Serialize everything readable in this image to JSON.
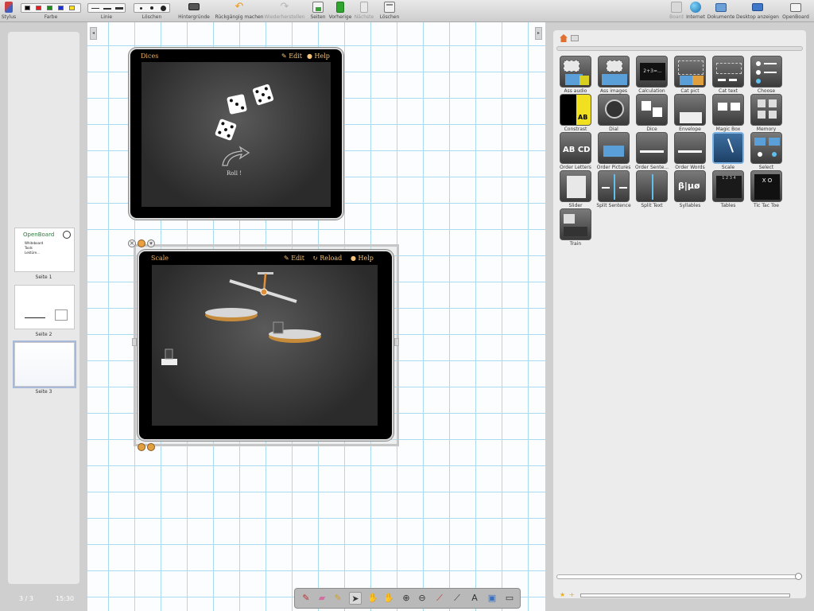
{
  "toolbar": {
    "stylus": "Stylus",
    "color": "Farbe",
    "colors": [
      "#000000",
      "#e02020",
      "#1f8a1f",
      "#2030d0",
      "#ffe020"
    ],
    "line": "Linie",
    "erase": "Löschen",
    "backgrounds": "Hintergründe",
    "undo": "Rückgängig machen",
    "redo": "Wiederherstellen",
    "pages": "Seiten",
    "previous": "Vorherige",
    "next": "Nächste",
    "delete": "Löschen",
    "board": "Board",
    "internet": "Internet",
    "documents": "Dokumente",
    "show_desktop": "Desktop anzeigen",
    "openboard": "OpenBoard"
  },
  "pages": [
    {
      "label": "Seite 1",
      "title": "OpenBoard",
      "lines": [
        "Whiteboard",
        "Tools",
        "Lektüre..."
      ]
    },
    {
      "label": "Seite 2"
    },
    {
      "label": "Seite 3"
    }
  ],
  "status": {
    "page_counter": "3 / 3",
    "time": "15:30"
  },
  "dices_widget": {
    "title": "Dices",
    "edit": "Edit",
    "help": "Help",
    "roll": "Roll !"
  },
  "scale_widget": {
    "title": "Scale",
    "edit": "Edit",
    "reload": "Reload",
    "help": "Help"
  },
  "library": {
    "items": [
      "Ass audio",
      "Ass images",
      "Calculation",
      "Cat pict",
      "Cat text",
      "Choose",
      "Constrast",
      "Dial",
      "Dice",
      "Envelope",
      "Magic Box",
      "Memory",
      "Order Letters",
      "Order Pictures",
      "Order Sente...",
      "Order Words",
      "Scale",
      "Select",
      "Slider",
      "Split Sentence",
      "Split Text",
      "Syllables",
      "Tables",
      "Tic Tac Toe",
      "Train"
    ],
    "selected": "Scale"
  },
  "icons": {
    "constrast_text": "AB",
    "order_letters_text": "AB CD",
    "syllables_text": "β|μø",
    "calc_text": "2+3=..."
  }
}
